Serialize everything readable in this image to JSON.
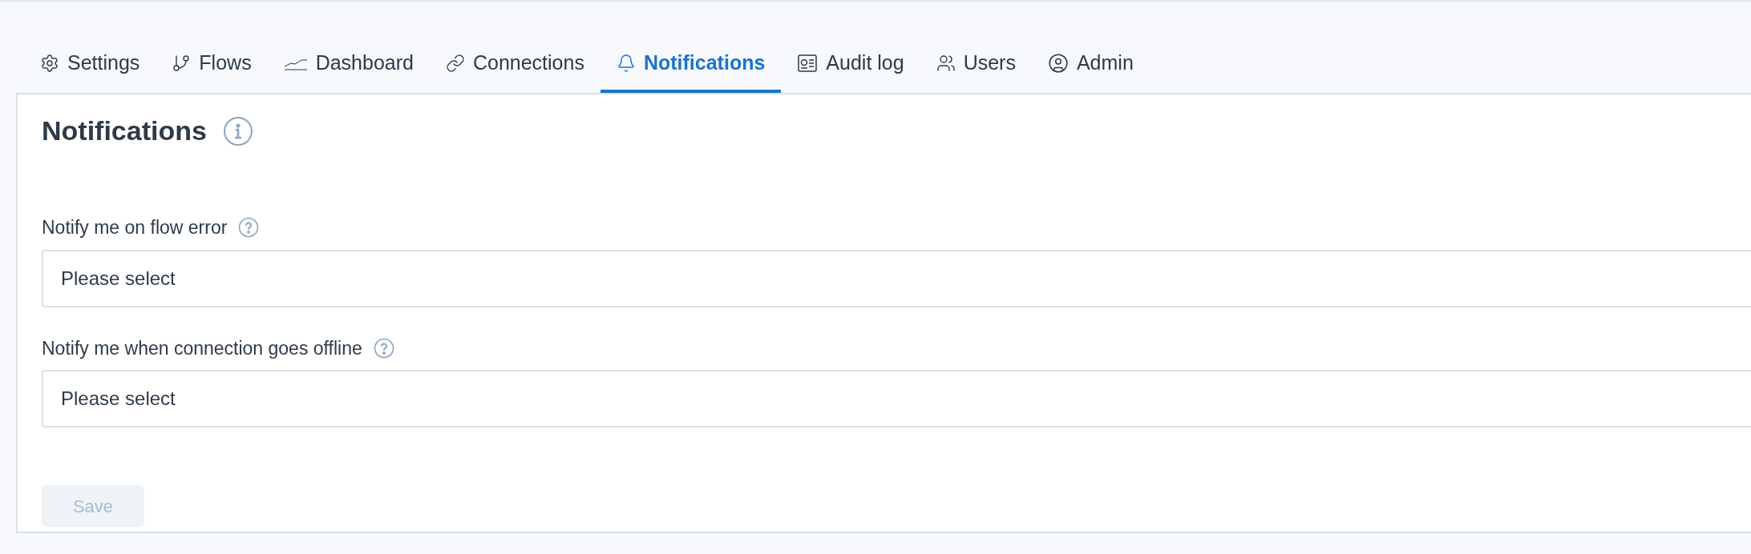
{
  "tabs": [
    {
      "label": "Settings",
      "selected": false
    },
    {
      "label": "Flows",
      "selected": false
    },
    {
      "label": "Dashboard",
      "selected": false
    },
    {
      "label": "Connections",
      "selected": false
    },
    {
      "label": "Notifications",
      "selected": true
    },
    {
      "label": "Audit log",
      "selected": false
    },
    {
      "label": "Users",
      "selected": false
    },
    {
      "label": "Admin",
      "selected": false
    }
  ],
  "panel": {
    "title": "Notifications",
    "fields": [
      {
        "label": "Notify me on flow error",
        "placeholder": "Please select"
      },
      {
        "label": "Notify me when connection goes offline",
        "placeholder": "Please select"
      }
    ],
    "save_button": {
      "label": "Save",
      "disabled": true
    }
  }
}
